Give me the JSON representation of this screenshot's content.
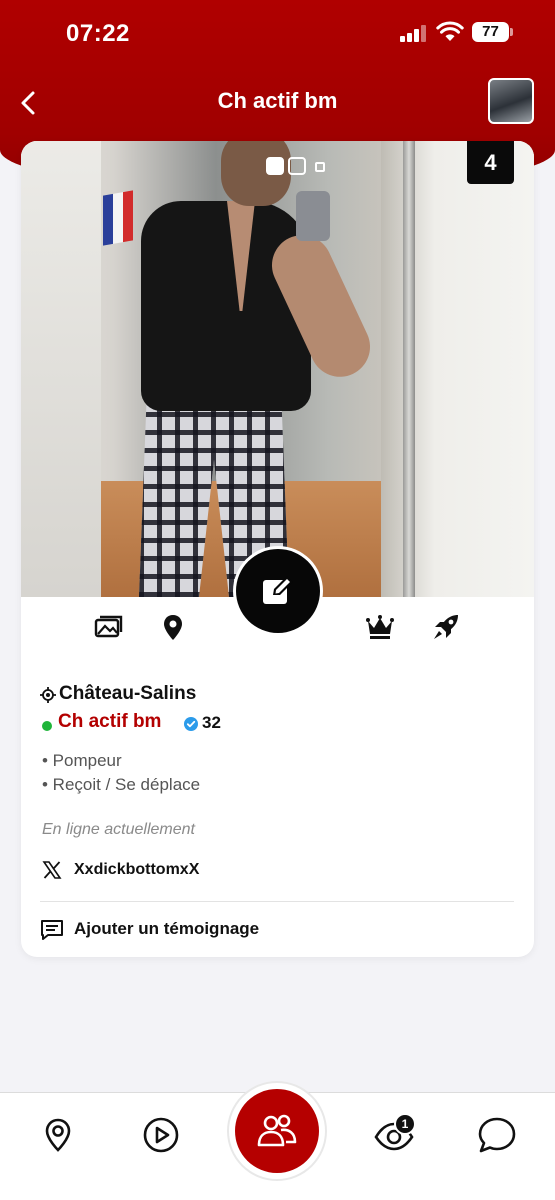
{
  "status_bar": {
    "time": "07:22",
    "battery": "77"
  },
  "nav": {
    "title": "Ch actif bm"
  },
  "photo": {
    "counter": "4",
    "dots_total": 3,
    "dots_active": 1
  },
  "profile": {
    "location": "Château-Salins",
    "name": "Ch actif bm",
    "age": "32",
    "tags": [
      "• Pompeur",
      "• Reçoit / Se déplace"
    ],
    "status": "En ligne actuellement",
    "x_handle": "XxdickbottomxX",
    "add_testimonial": "Ajouter un témoignage"
  },
  "tabbar": {
    "views_badge": "1"
  },
  "colors": {
    "brand_red": "#b00000",
    "online_green": "#1fb53a",
    "verified_blue": "#2b9bea"
  },
  "icons": {
    "photo_bar": [
      "photos-icon",
      "location-pin-icon",
      "edit-icon",
      "crown-icon",
      "rocket-icon"
    ],
    "tabs": [
      "map-pin-icon",
      "play-icon",
      "people-icon",
      "eye-icon",
      "chat-icon"
    ]
  }
}
